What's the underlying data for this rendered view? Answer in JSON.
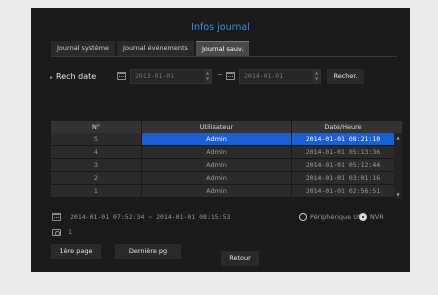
{
  "title": "Infos journal",
  "tabs": [
    {
      "label": "Journal système",
      "active": false
    },
    {
      "label": "Journal événements",
      "active": false
    },
    {
      "label": "Journal sauv.",
      "active": true
    }
  ],
  "search": {
    "label": "Rech date",
    "start_date": "2013-01-01",
    "separator": "~",
    "end_date": "2014-01-01",
    "button": "Recher."
  },
  "table": {
    "headers": [
      "N°",
      "Utilisateur",
      "Date/Heure"
    ],
    "rows": [
      {
        "n": "5",
        "user": "Admin",
        "datetime": "2014-01-01 08:21:10",
        "selected": true
      },
      {
        "n": "4",
        "user": "Admin",
        "datetime": "2014-01-01 05:13:36",
        "selected": false
      },
      {
        "n": "3",
        "user": "Admin",
        "datetime": "2014-01-01 05:12:44",
        "selected": false
      },
      {
        "n": "2",
        "user": "Admin",
        "datetime": "2014-01-01 03:01:16",
        "selected": false
      },
      {
        "n": "1",
        "user": "Admin",
        "datetime": "2014-01-01 02:56:51",
        "selected": false
      }
    ]
  },
  "details": {
    "range": "2014-01-01 07:52:34 ~ 2014-01-01 08:15:53",
    "device": "Périphérique USB",
    "type": "NVR",
    "count": "1"
  },
  "pagination": {
    "first": "1ère page",
    "last": "Dernière pg"
  },
  "back": "Retour",
  "colors": {
    "accent": "#3a8ef0",
    "selection": "#1a5fd6",
    "panel_bg": "#1a1a1a"
  }
}
